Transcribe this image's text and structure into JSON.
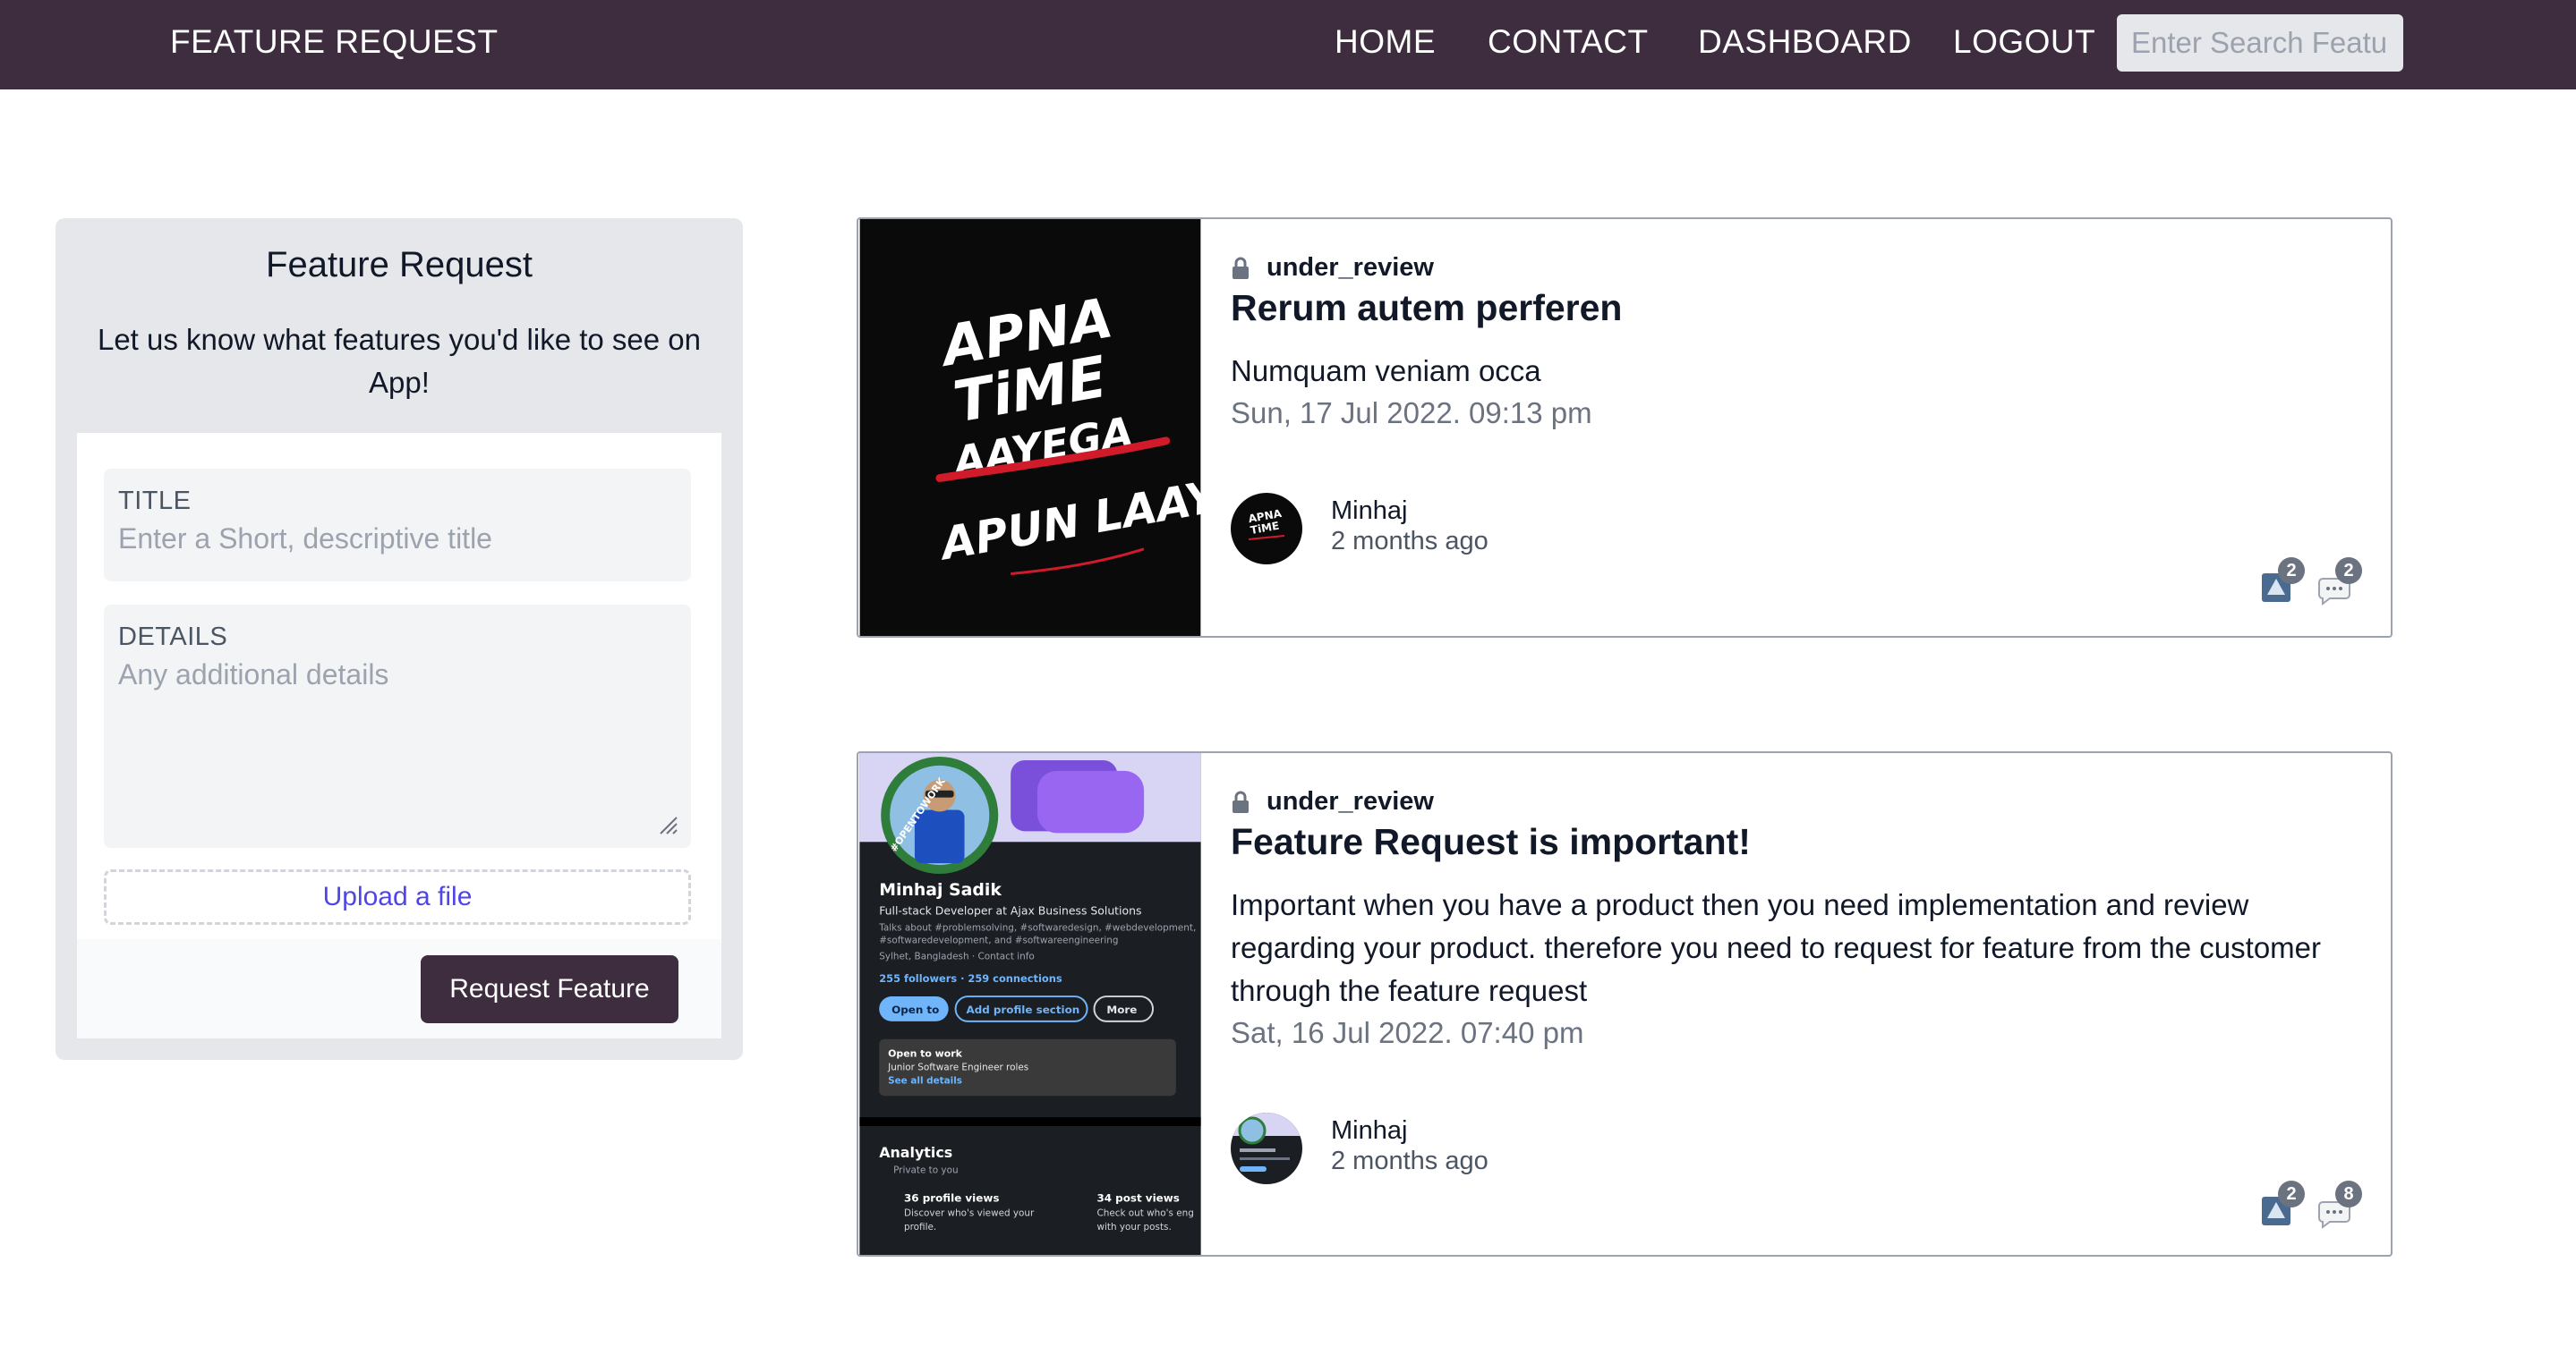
{
  "nav": {
    "brand": "FEATURE REQUEST",
    "links": [
      "HOME",
      "CONTACT",
      "DASHBOARD",
      "LOGOUT"
    ],
    "search_placeholder": "Enter Search Featu"
  },
  "form": {
    "title": "Feature Request",
    "subtitle": "Let us know what features you'd like to see on App!",
    "title_label": "TITLE",
    "title_placeholder": "Enter a Short, descriptive title",
    "details_label": "DETAILS",
    "details_placeholder": "Any additional details",
    "upload_label": "Upload a file",
    "submit_label": "Request Feature"
  },
  "posts": [
    {
      "status": "under_review",
      "title": "Rerum autem perferen",
      "description": "Numquam veniam occa",
      "date": "Sun, 17 Jul 2022. 09:13 pm",
      "author": "Minhaj",
      "time_ago": "2 months ago",
      "votes": "2",
      "comments": "2",
      "image_text": [
        "APNA",
        "TiME",
        "AAYEGA",
        "APUN LAAYEGA"
      ]
    },
    {
      "status": "under_review",
      "title": "Feature Request is important!",
      "description": "Important when you have a product then you need implementation and review regarding your product. therefore you need to request for feature from the customer through the feature request",
      "date": "Sat, 16 Jul 2022. 07:40 pm",
      "author": "Minhaj",
      "time_ago": "2 months ago",
      "votes": "2",
      "comments": "8",
      "image_text": {
        "ring": "#OPENTOWORK",
        "name": "Minhaj Sadik",
        "headline": "Full-stack Developer at Ajax Business Solutions",
        "talks": "Talks about #problemsolving, #softwaredesign, #webdevelopment,",
        "talks2": "#softwaredevelopment, and #softwareengineering",
        "location": "Sylhet, Bangladesh · Contact info",
        "stats": "255 followers · 259 connections",
        "btn_open": "Open to",
        "btn_add": "Add profile section",
        "btn_more": "More",
        "otw_title": "Open to work",
        "otw_role": "Junior Software Engineer roles",
        "otw_link": "See all details",
        "analytics": "Analytics",
        "private": "Private to you",
        "views": "36 profile views",
        "views_sub": "Discover who's viewed your",
        "views_sub2": "profile.",
        "posts": "34 post views",
        "posts_sub": "Check out who's eng",
        "posts_sub2": "with your posts."
      }
    }
  ],
  "colors": {
    "nav_bg": "#3d2d3f",
    "link": "#4f46e5",
    "badge": "#6b7280"
  }
}
